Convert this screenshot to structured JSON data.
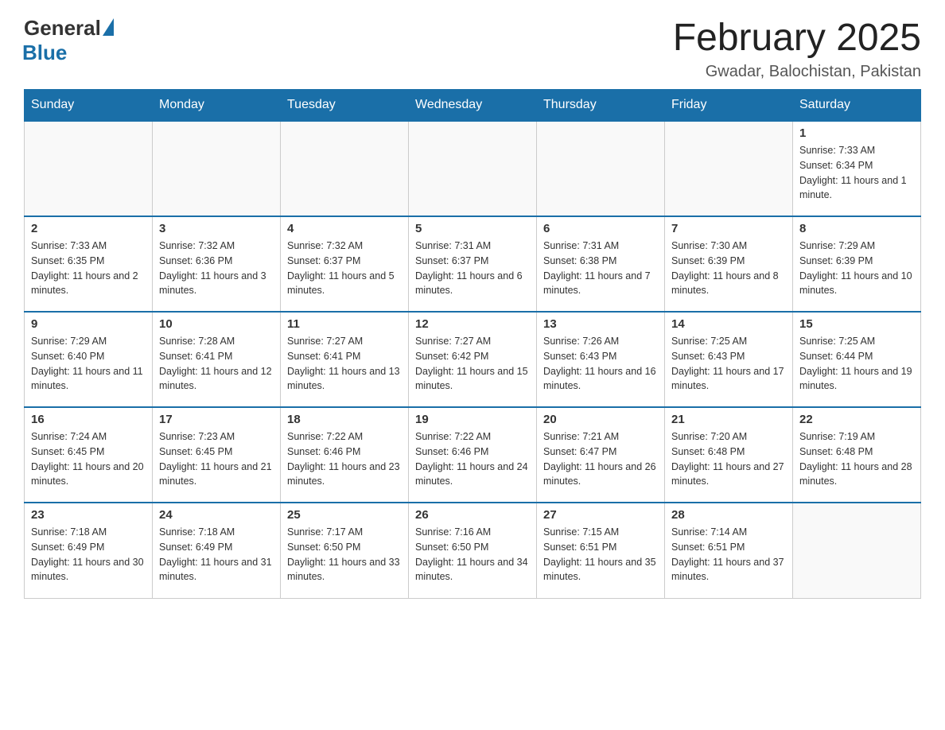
{
  "header": {
    "logo_general": "General",
    "logo_blue": "Blue",
    "month_title": "February 2025",
    "location": "Gwadar, Balochistan, Pakistan"
  },
  "days_of_week": [
    "Sunday",
    "Monday",
    "Tuesday",
    "Wednesday",
    "Thursday",
    "Friday",
    "Saturday"
  ],
  "weeks": [
    [
      {
        "day": "",
        "info": ""
      },
      {
        "day": "",
        "info": ""
      },
      {
        "day": "",
        "info": ""
      },
      {
        "day": "",
        "info": ""
      },
      {
        "day": "",
        "info": ""
      },
      {
        "day": "",
        "info": ""
      },
      {
        "day": "1",
        "info": "Sunrise: 7:33 AM\nSunset: 6:34 PM\nDaylight: 11 hours and 1 minute."
      }
    ],
    [
      {
        "day": "2",
        "info": "Sunrise: 7:33 AM\nSunset: 6:35 PM\nDaylight: 11 hours and 2 minutes."
      },
      {
        "day": "3",
        "info": "Sunrise: 7:32 AM\nSunset: 6:36 PM\nDaylight: 11 hours and 3 minutes."
      },
      {
        "day": "4",
        "info": "Sunrise: 7:32 AM\nSunset: 6:37 PM\nDaylight: 11 hours and 5 minutes."
      },
      {
        "day": "5",
        "info": "Sunrise: 7:31 AM\nSunset: 6:37 PM\nDaylight: 11 hours and 6 minutes."
      },
      {
        "day": "6",
        "info": "Sunrise: 7:31 AM\nSunset: 6:38 PM\nDaylight: 11 hours and 7 minutes."
      },
      {
        "day": "7",
        "info": "Sunrise: 7:30 AM\nSunset: 6:39 PM\nDaylight: 11 hours and 8 minutes."
      },
      {
        "day": "8",
        "info": "Sunrise: 7:29 AM\nSunset: 6:39 PM\nDaylight: 11 hours and 10 minutes."
      }
    ],
    [
      {
        "day": "9",
        "info": "Sunrise: 7:29 AM\nSunset: 6:40 PM\nDaylight: 11 hours and 11 minutes."
      },
      {
        "day": "10",
        "info": "Sunrise: 7:28 AM\nSunset: 6:41 PM\nDaylight: 11 hours and 12 minutes."
      },
      {
        "day": "11",
        "info": "Sunrise: 7:27 AM\nSunset: 6:41 PM\nDaylight: 11 hours and 13 minutes."
      },
      {
        "day": "12",
        "info": "Sunrise: 7:27 AM\nSunset: 6:42 PM\nDaylight: 11 hours and 15 minutes."
      },
      {
        "day": "13",
        "info": "Sunrise: 7:26 AM\nSunset: 6:43 PM\nDaylight: 11 hours and 16 minutes."
      },
      {
        "day": "14",
        "info": "Sunrise: 7:25 AM\nSunset: 6:43 PM\nDaylight: 11 hours and 17 minutes."
      },
      {
        "day": "15",
        "info": "Sunrise: 7:25 AM\nSunset: 6:44 PM\nDaylight: 11 hours and 19 minutes."
      }
    ],
    [
      {
        "day": "16",
        "info": "Sunrise: 7:24 AM\nSunset: 6:45 PM\nDaylight: 11 hours and 20 minutes."
      },
      {
        "day": "17",
        "info": "Sunrise: 7:23 AM\nSunset: 6:45 PM\nDaylight: 11 hours and 21 minutes."
      },
      {
        "day": "18",
        "info": "Sunrise: 7:22 AM\nSunset: 6:46 PM\nDaylight: 11 hours and 23 minutes."
      },
      {
        "day": "19",
        "info": "Sunrise: 7:22 AM\nSunset: 6:46 PM\nDaylight: 11 hours and 24 minutes."
      },
      {
        "day": "20",
        "info": "Sunrise: 7:21 AM\nSunset: 6:47 PM\nDaylight: 11 hours and 26 minutes."
      },
      {
        "day": "21",
        "info": "Sunrise: 7:20 AM\nSunset: 6:48 PM\nDaylight: 11 hours and 27 minutes."
      },
      {
        "day": "22",
        "info": "Sunrise: 7:19 AM\nSunset: 6:48 PM\nDaylight: 11 hours and 28 minutes."
      }
    ],
    [
      {
        "day": "23",
        "info": "Sunrise: 7:18 AM\nSunset: 6:49 PM\nDaylight: 11 hours and 30 minutes."
      },
      {
        "day": "24",
        "info": "Sunrise: 7:18 AM\nSunset: 6:49 PM\nDaylight: 11 hours and 31 minutes."
      },
      {
        "day": "25",
        "info": "Sunrise: 7:17 AM\nSunset: 6:50 PM\nDaylight: 11 hours and 33 minutes."
      },
      {
        "day": "26",
        "info": "Sunrise: 7:16 AM\nSunset: 6:50 PM\nDaylight: 11 hours and 34 minutes."
      },
      {
        "day": "27",
        "info": "Sunrise: 7:15 AM\nSunset: 6:51 PM\nDaylight: 11 hours and 35 minutes."
      },
      {
        "day": "28",
        "info": "Sunrise: 7:14 AM\nSunset: 6:51 PM\nDaylight: 11 hours and 37 minutes."
      },
      {
        "day": "",
        "info": ""
      }
    ]
  ]
}
